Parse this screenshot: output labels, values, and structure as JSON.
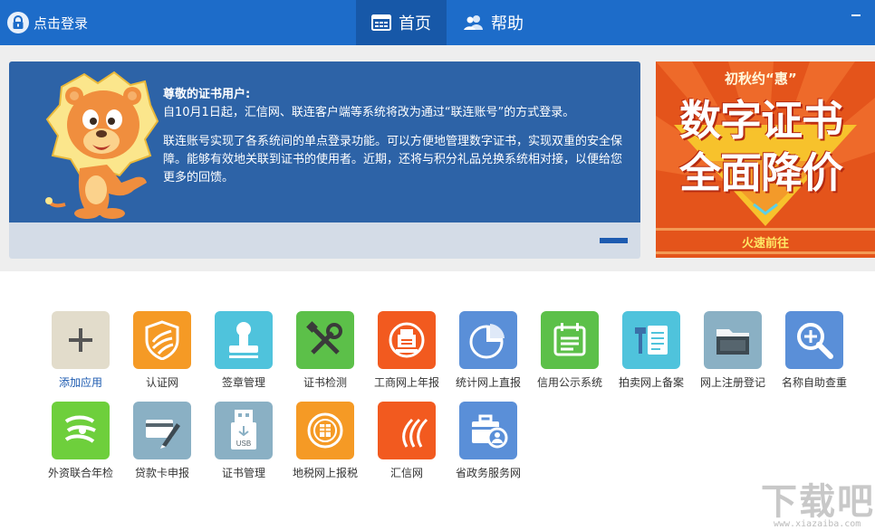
{
  "header": {
    "login_label": "点击登录",
    "tabs": [
      {
        "label": "首页",
        "active": true
      },
      {
        "label": "帮助",
        "active": false
      }
    ]
  },
  "notice": {
    "title": "尊敬的证书用户:",
    "paragraph1": "自10月1日起，汇信网、联连客户端等系统将改为通过“联连账号”的方式登录。",
    "paragraph2": "联连账号实现了各系统间的单点登录功能。可以方便地管理数字证书，实现双重的安全保障。能够有效地关联到证书的使用者。近期，还将与积分礼品兑换系统相对接，以便给您更多的回馈。"
  },
  "ad": {
    "slogan": "初秋约“惠”",
    "line1": "数字证书",
    "line2": "全面降价",
    "cta": "火速前往"
  },
  "apps": [
    {
      "label": "添加应用",
      "icon": "plus-icon",
      "color": "#e2dccb"
    },
    {
      "label": "认证网",
      "icon": "shield-icon",
      "color": "#f59a25"
    },
    {
      "label": "签章管理",
      "icon": "stamp-icon",
      "color": "#4fc3dc"
    },
    {
      "label": "证书检测",
      "icon": "tools-icon",
      "color": "#5cc049"
    },
    {
      "label": "工商网上年报",
      "icon": "emblem-icon",
      "color": "#f25a1f"
    },
    {
      "label": "统计网上直报",
      "icon": "pie-chart-icon",
      "color": "#5a8fd8"
    },
    {
      "label": "信用公示系统",
      "icon": "calendar-board-icon",
      "color": "#5cc049"
    },
    {
      "label": "拍卖网上备案",
      "icon": "gavel-document-icon",
      "color": "#4fc3dc"
    },
    {
      "label": "网上注册登记",
      "icon": "folder-icon",
      "color": "#8ab0c4"
    },
    {
      "label": "名称自助查重",
      "icon": "magnifier-plus-icon",
      "color": "#5a8fd8"
    },
    {
      "label": "外资联合年检",
      "icon": "foreign-logo-icon",
      "color": "#6ecf3c"
    },
    {
      "label": "贷款卡申报",
      "icon": "card-pen-icon",
      "color": "#8ab0c4"
    },
    {
      "label": "证书管理",
      "icon": "usb-key-icon",
      "color": "#8ab0c4"
    },
    {
      "label": "地税网上报税",
      "icon": "tax-seal-icon",
      "color": "#f59a25"
    },
    {
      "label": "汇信网",
      "icon": "icinfo-logo-icon",
      "color": "#f25a1f"
    },
    {
      "label": "省政务服务网",
      "icon": "briefcase-user-icon",
      "color": "#5a8fd8"
    }
  ],
  "watermark": {
    "zh": "下载吧",
    "en": "www.xiazaiba.com"
  }
}
